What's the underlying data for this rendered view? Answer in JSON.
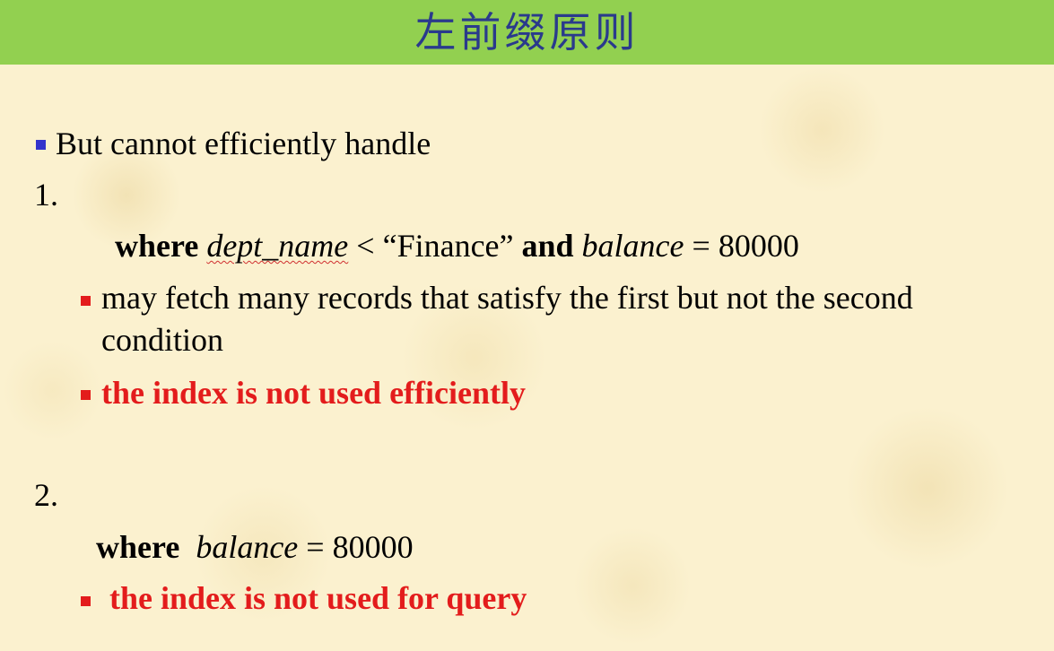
{
  "slide": {
    "title": "左前缀原则",
    "intro": "But cannot efficiently handle",
    "case1": {
      "number": "1.",
      "query": {
        "where_kw": "where",
        "attr1": "dept_name",
        "op1": "< “Finance”",
        "and_kw": "and",
        "attr2": "balance",
        "op2": "= 80000"
      },
      "bullet1_line1": "may fetch many records that satisfy the first but not the second",
      "bullet1_line2": "condition",
      "bullet2": "the index is not used efficiently"
    },
    "case2": {
      "number": "2.",
      "query": {
        "where_kw": "where",
        "attr": "balance",
        "op": "= 80000"
      },
      "bullet": "the index is not used for query"
    }
  },
  "colors": {
    "title_bar": "#92d050",
    "title_text": "#2a3a8c",
    "background": "#fbf1cf",
    "blue_bullet": "#3333cc",
    "red_accent": "#e31c1c"
  }
}
